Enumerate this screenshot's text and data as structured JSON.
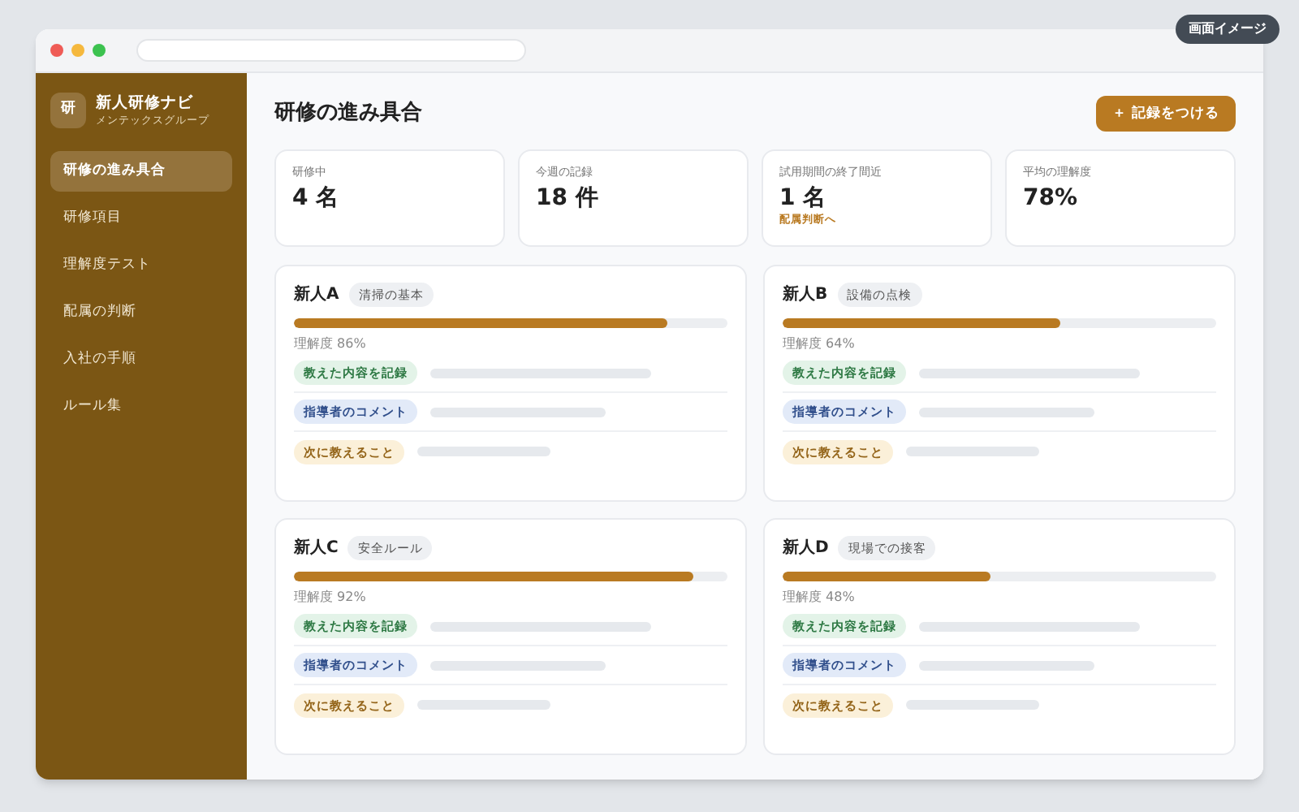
{
  "badge": "画面イメージ",
  "app": {
    "logo": "研",
    "name": "新人研修ナビ",
    "company": "メンテックスグループ"
  },
  "sidebar": {
    "items": [
      {
        "label": "研修の進み具合",
        "selected": true
      },
      {
        "label": "研修項目",
        "selected": false
      },
      {
        "label": "理解度テスト",
        "selected": false
      },
      {
        "label": "配属の判断",
        "selected": false
      },
      {
        "label": "入社の手順",
        "selected": false
      },
      {
        "label": "ルール集",
        "selected": false
      }
    ]
  },
  "page": {
    "title": "研修の進み具合",
    "button": "＋ 記録をつける"
  },
  "stats": [
    {
      "label": "研修中",
      "value": "4 名"
    },
    {
      "label": "今週の記録",
      "value": "18 件"
    },
    {
      "label": "試用期間の終了間近",
      "value": "1 名",
      "link": "配属判断へ"
    },
    {
      "label": "平均の理解度",
      "value": "78%"
    }
  ],
  "trainees": [
    {
      "name": "新人A",
      "topic": "清掃の基本",
      "level": 0.86,
      "reading": "理解度 86%",
      "records": [
        {
          "kind": "record",
          "label": "教えた内容を記録"
        },
        {
          "kind": "comment",
          "label": "指導者のコメント"
        },
        {
          "kind": "next",
          "label": "次に教えること"
        }
      ]
    },
    {
      "name": "新人B",
      "topic": "設備の点検",
      "level": 0.64,
      "reading": "理解度 64%",
      "records": [
        {
          "kind": "record",
          "label": "教えた内容を記録"
        },
        {
          "kind": "comment",
          "label": "指導者のコメント"
        },
        {
          "kind": "next",
          "label": "次に教えること"
        }
      ]
    },
    {
      "name": "新人C",
      "topic": "安全ルール",
      "level": 0.92,
      "reading": "理解度 92%",
      "records": [
        {
          "kind": "record",
          "label": "教えた内容を記録"
        },
        {
          "kind": "comment",
          "label": "指導者のコメント"
        },
        {
          "kind": "next",
          "label": "次に教えること"
        }
      ]
    },
    {
      "name": "新人D",
      "topic": "現場での接客",
      "level": 0.48,
      "reading": "理解度 48%",
      "records": [
        {
          "kind": "record",
          "label": "教えた内容を記録"
        },
        {
          "kind": "comment",
          "label": "指導者のコメント"
        },
        {
          "kind": "next",
          "label": "次に教えること"
        }
      ]
    }
  ]
}
